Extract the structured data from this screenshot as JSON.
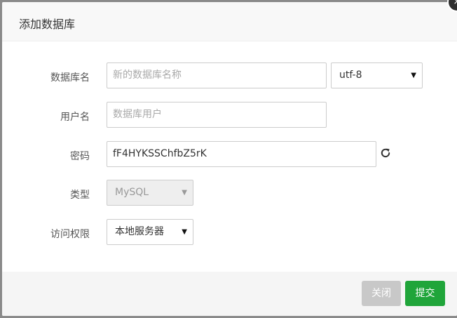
{
  "dialog": {
    "title": "添加数据库",
    "close_symbol": "×"
  },
  "form": {
    "db_name": {
      "label": "数据库名",
      "placeholder": "新的数据库名称",
      "value": ""
    },
    "charset": {
      "value": "utf-8"
    },
    "username": {
      "label": "用户名",
      "placeholder": "数据库用户",
      "value": ""
    },
    "password": {
      "label": "密码",
      "value": "fF4HYKSSChfbZ5rK"
    },
    "type": {
      "label": "类型",
      "value": "MySQL",
      "disabled": true
    },
    "access": {
      "label": "访问权限",
      "value": "本地服务器"
    },
    "caret": "▼"
  },
  "footer": {
    "close_label": "关闭",
    "submit_label": "提交"
  },
  "colors": {
    "submit": "#20a53a",
    "close_disabled": "#c8c8c8"
  },
  "icons": {
    "refresh": "refresh-icon",
    "dialog_close": "close-icon",
    "dropdown": "caret-down-icon"
  }
}
